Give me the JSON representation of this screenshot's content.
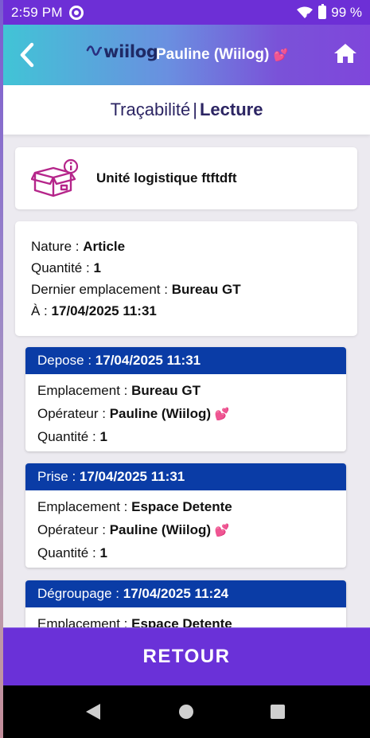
{
  "status_bar": {
    "time": "2:59 PM",
    "battery": "99 %",
    "icons": [
      "sync-icon",
      "wifi-icon",
      "battery-icon"
    ]
  },
  "header": {
    "logo_text": "wiilog",
    "user": "Pauline (Wiilog)",
    "user_emoji": "💕",
    "back_icon": "chevron-left-icon",
    "home_icon": "home-icon"
  },
  "title": {
    "part1": "Traçabilité",
    "separator": "|",
    "part2": "Lecture"
  },
  "unit": {
    "label": "Unité logistique ftftdft",
    "icon": "box-info-icon"
  },
  "info": {
    "nature_label": "Nature : ",
    "nature_value": "Article",
    "quantity_label": "Quantité : ",
    "quantity_value": "1",
    "location_label": "Dernier emplacement : ",
    "location_value": "Bureau GT",
    "date_label": "À : ",
    "date_value": "17/04/2025 11:31"
  },
  "movements": [
    {
      "type": "Depose",
      "date": "17/04/2025 11:31",
      "location": "Bureau GT",
      "operator": "Pauline (Wiilog)",
      "quantity": "1"
    },
    {
      "type": "Prise",
      "date": "17/04/2025 11:31",
      "location": "Espace Detente",
      "operator": "Pauline (Wiilog)",
      "quantity": "1"
    },
    {
      "type": "Dégroupage",
      "date": "17/04/2025 11:24",
      "location": "Espace Detente",
      "operator": "",
      "quantity": ""
    }
  ],
  "labels": {
    "location": "Emplacement : ",
    "operator": "Opérateur : ",
    "quantity": "Quantité : ",
    "heart": "💕"
  },
  "retour_label": "RETOUR",
  "colors": {
    "status_bar": "#6d2fd6",
    "movement_header": "#0a3ca6",
    "retour_button": "#6a31d8",
    "title_text": "#2c2563"
  }
}
